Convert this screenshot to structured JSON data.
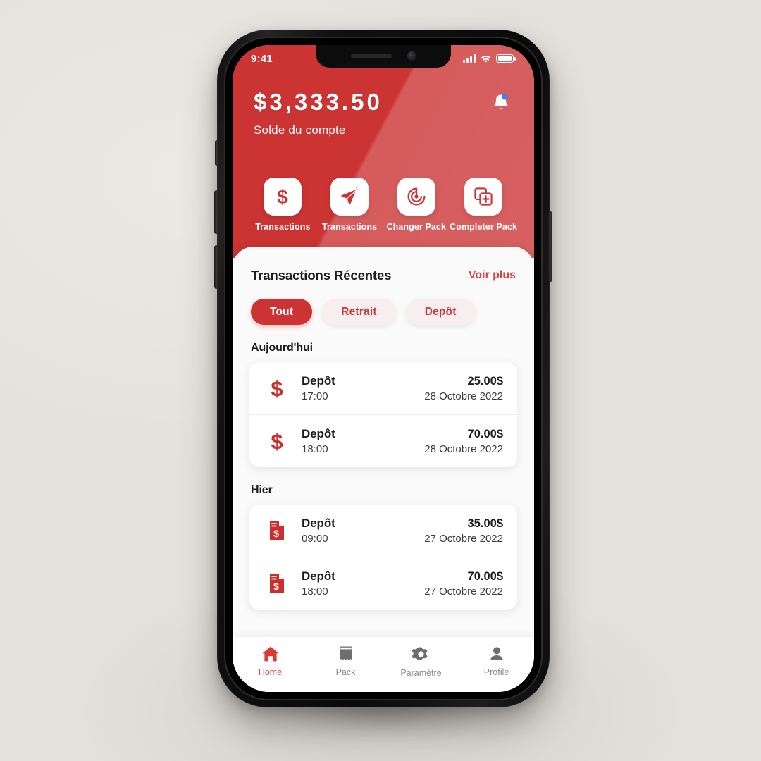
{
  "theme": {
    "primary_red": "#CC3333",
    "light_red": "#D35F62",
    "accent_link": "#D84545",
    "notification_dot": "#3B82F6",
    "scene_background": "#E6E3DF"
  },
  "status_bar": {
    "time": "9:41",
    "signal_icon": "signal-bars-icon",
    "wifi_icon": "wifi-icon",
    "battery_icon": "battery-full-icon"
  },
  "header": {
    "balance_amount": "$3,333.50",
    "balance_label": "Solde du compte",
    "notification_icon": "bell-icon",
    "actions": [
      {
        "label": "Transactions",
        "icon": "dollar-icon"
      },
      {
        "label": "Transactions",
        "icon": "send-icon"
      },
      {
        "label": "Changer Pack",
        "icon": "target-refresh-icon"
      },
      {
        "label": "Completer Pack",
        "icon": "add-layers-icon"
      }
    ]
  },
  "transactions_panel": {
    "title": "Transactions Récentes",
    "see_more": "Voir plus",
    "filters": [
      {
        "label": "Tout",
        "active": true
      },
      {
        "label": "Retrait",
        "active": false
      },
      {
        "label": "Depôt",
        "active": false
      }
    ],
    "groups": [
      {
        "label": "Aujourd'hui",
        "icon": "dollar-sign-icon",
        "items": [
          {
            "title": "Depôt",
            "time": "17:00",
            "amount": "25.00$",
            "date": "28 Octobre 2022"
          },
          {
            "title": "Depôt",
            "time": "18:00",
            "amount": "70.00$",
            "date": "28 Octobre 2022"
          }
        ]
      },
      {
        "label": "Hier",
        "icon": "invoice-dollar-icon",
        "items": [
          {
            "title": "Depôt",
            "time": "09:00",
            "amount": "35.00$",
            "date": "27 Octobre 2022"
          },
          {
            "title": "Depôt",
            "time": "18:00",
            "amount": "70.00$",
            "date": "27 Octobre 2022"
          }
        ]
      }
    ]
  },
  "tabbar": {
    "items": [
      {
        "label": "Home",
        "icon": "home-icon",
        "active": true
      },
      {
        "label": "Pack",
        "icon": "receipt-icon",
        "active": false
      },
      {
        "label": "Paramètre",
        "icon": "gear-icon",
        "active": false
      },
      {
        "label": "Profile",
        "icon": "user-icon",
        "active": false
      }
    ]
  }
}
